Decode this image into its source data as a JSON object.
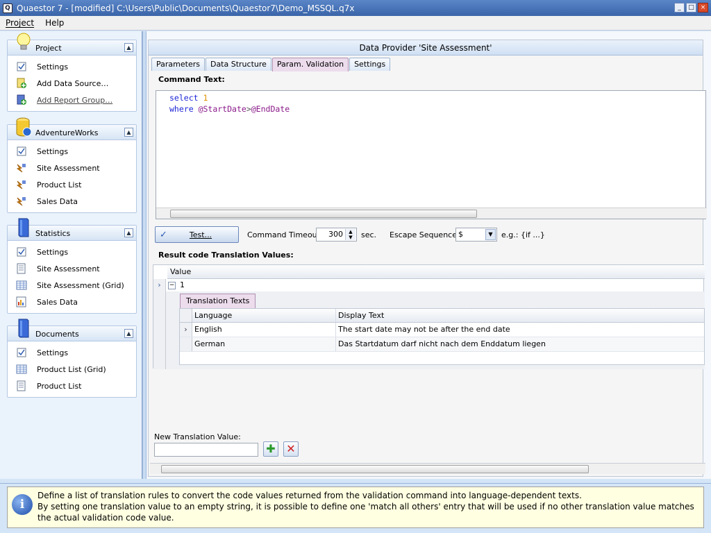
{
  "window": {
    "title": "Quaestor 7 - [modified] C:\\Users\\Public\\Documents\\Quaestor7\\Demo_MSSQL.q7x",
    "icon_text": "Q",
    "min": "_",
    "max": "□",
    "close": "×"
  },
  "menu": {
    "project": "Project",
    "help": "Help"
  },
  "sidebar": {
    "groups": [
      {
        "title": "Project",
        "icon": "bulb-icon",
        "items": [
          {
            "label": "Settings",
            "icon": "settings-icon"
          },
          {
            "label": "Add Data Source…",
            "icon": "add-datasource-icon"
          },
          {
            "label": "Add Report Group…",
            "icon": "add-reportgroup-icon"
          }
        ]
      },
      {
        "title": "AdventureWorks",
        "icon": "database-icon",
        "items": [
          {
            "label": "Settings",
            "icon": "settings-icon"
          },
          {
            "label": "Site Assessment",
            "icon": "dataprovider-icon"
          },
          {
            "label": "Product List",
            "icon": "dataprovider-icon"
          },
          {
            "label": "Sales Data",
            "icon": "dataprovider-icon"
          }
        ]
      },
      {
        "title": "Statistics",
        "icon": "book-icon",
        "items": [
          {
            "label": "Settings",
            "icon": "settings-icon"
          },
          {
            "label": "Site Assessment",
            "icon": "report-icon"
          },
          {
            "label": "Site Assessment (Grid)",
            "icon": "grid-report-icon"
          },
          {
            "label": "Sales Data",
            "icon": "chart-report-icon"
          }
        ]
      },
      {
        "title": "Documents",
        "icon": "book-icon",
        "items": [
          {
            "label": "Settings",
            "icon": "settings-icon"
          },
          {
            "label": "Product List (Grid)",
            "icon": "grid-report-icon"
          },
          {
            "label": "Product List",
            "icon": "report-icon"
          }
        ]
      }
    ],
    "collapse_glyph": "▲"
  },
  "main": {
    "header": "Data Provider 'Site Assessment'",
    "tabs": [
      "Parameters",
      "Data Structure",
      "Param. Validation",
      "Settings"
    ],
    "active_tab": "Param. Validation",
    "command_text_label": "Command Text:",
    "code": {
      "l1_kw": "select",
      "l1_num": "1",
      "l2_kw": "where",
      "l2_v1": "@StartDate",
      "l2_op": ">",
      "l2_v2": "@EndDate"
    },
    "test_button": "Test...",
    "timeout_label": "Command Timeout:",
    "timeout_value": "300",
    "sec_label": "sec.",
    "escape_label": "Escape Sequence:",
    "escape_value": "$",
    "escape_example": "e.g.: {if ...}",
    "result_label": "Result code Translation Values:",
    "grid": {
      "column": "Value",
      "row_value": "1",
      "subtab": "Translation Texts",
      "columns": [
        "Language",
        "Display Text"
      ],
      "rows": [
        {
          "language": "English",
          "text": "The start date may not be after the end date"
        },
        {
          "language": "German",
          "text": "Das Startdatum darf nicht nach dem Enddatum liegen"
        }
      ]
    },
    "new_value_label": "New Translation Value:",
    "new_value": "",
    "add_glyph": "✚",
    "delete_glyph": "✕"
  },
  "info": {
    "line1": "Define a list of translation rules to convert the code values returned from the validation command into language-dependent texts.",
    "line2": "By setting one translation value to an empty string, it is possible to define one 'match all others' entry that will be used if no other translation value matches the actual validation code value."
  },
  "colors": {
    "titlebar": "#3a64a8",
    "accent": "#2a5ab0",
    "active_tab": "#ecdcec",
    "info_bg": "#ffffe1"
  }
}
